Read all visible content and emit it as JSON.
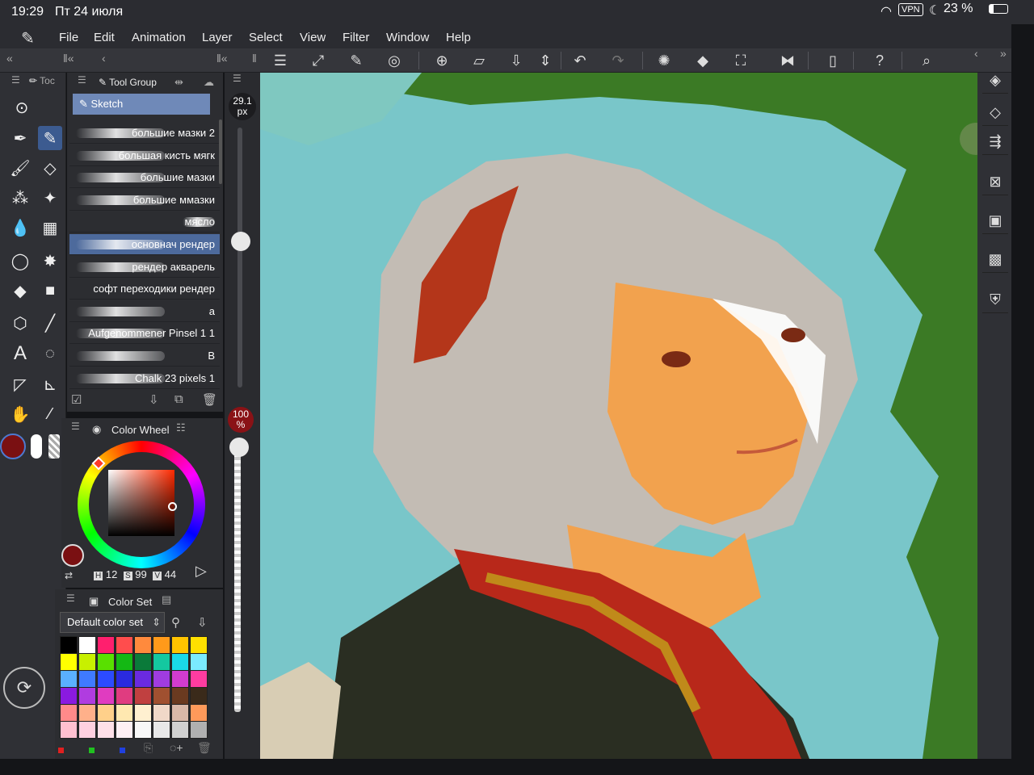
{
  "status": {
    "time": "19:29",
    "date": "Пт 24 июля",
    "battery": "23 %",
    "vpn": "VPN"
  },
  "menu": {
    "items": [
      "File",
      "Edit",
      "Animation",
      "Layer",
      "Select",
      "View",
      "Filter",
      "Window",
      "Help"
    ]
  },
  "tool_panel": {
    "tab1": "Toc",
    "tab2": "Tool Group",
    "subtool": "Sketch"
  },
  "brushes": [
    "большие мазки 2",
    "большая кисть мягк",
    "большие мазки",
    "большие ммазки",
    "мясло",
    "основнач рендер",
    "рендер акварель",
    "софт переходики рендер",
    "a",
    "Aufgenommener Pinsel 1 1",
    "B",
    "Chalk 23 pixels 1"
  ],
  "brush_size": {
    "value": "29.1",
    "unit": "px"
  },
  "opacity": {
    "value": "100",
    "unit": "%"
  },
  "color_wheel": {
    "title": "Color Wheel",
    "h_label": "H",
    "h": "12",
    "s_label": "S",
    "s": "99",
    "v_label": "V",
    "v": "44",
    "main_color": "#7a1012"
  },
  "color_set": {
    "title": "Color Set",
    "selected": "Default color set"
  },
  "palette": [
    "#000000",
    "#ffffff",
    "#ff1f6e",
    "#ff4d4d",
    "#ff8a3d",
    "#ff9a1a",
    "#ffc400",
    "#ffe000",
    "#ffff00",
    "#c8f000",
    "#59e000",
    "#14b814",
    "#0a7a3a",
    "#14c8a0",
    "#1ad8e8",
    "#7aeaff",
    "#5ab0ff",
    "#3f7aff",
    "#2c4bff",
    "#2a2ae0",
    "#6a2ae0",
    "#a03ce0",
    "#d23cd0",
    "#ff3ca0",
    "#8a1ae0",
    "#b03ce0",
    "#e03cc0",
    "#e03c80",
    "#c04040",
    "#a05030",
    "#6a3a20",
    "#3a2a1a",
    "#ff8a8a",
    "#ffb08a",
    "#ffd08a",
    "#ffe8b0",
    "#fff0d0",
    "#f0d8c8",
    "#d8b8a8",
    "#ff9a5a",
    "#ffc0d0",
    "#ffd0e0",
    "#ffe0e8",
    "#fff0f4",
    "#f8f8f8",
    "#e8e8e8",
    "#d0d0d0",
    "#b0b0b0"
  ],
  "accent": "#4d6a9c"
}
